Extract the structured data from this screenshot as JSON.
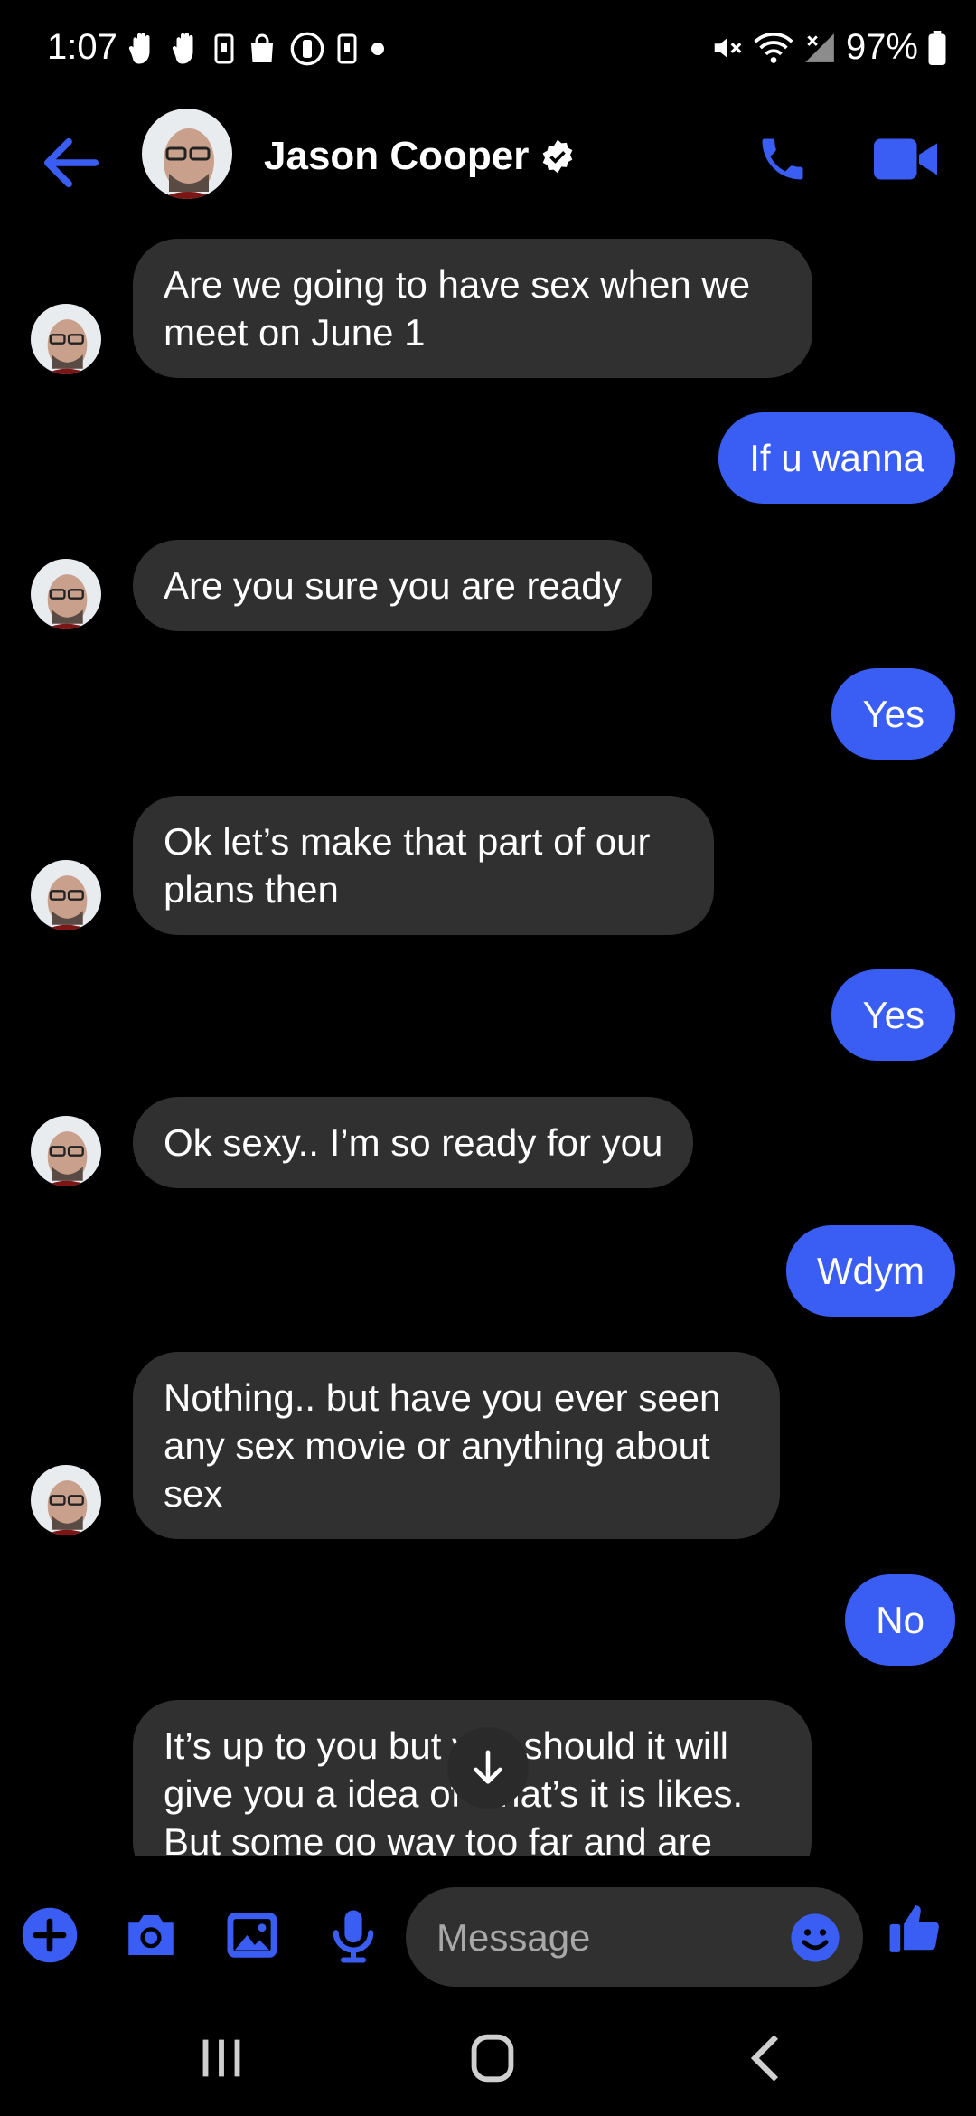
{
  "status_bar": {
    "time": "1:07",
    "battery": "97%"
  },
  "header": {
    "contact_name": "Jason Cooper",
    "accent_color": "#3a5ef4"
  },
  "messages": [
    {
      "sender": "contact",
      "text": "Are we going to have sex when we meet on June 1"
    },
    {
      "sender": "me",
      "text": "If u wanna"
    },
    {
      "sender": "contact",
      "text": "Are you sure you are ready"
    },
    {
      "sender": "me",
      "text": "Yes"
    },
    {
      "sender": "contact",
      "text": "Ok let’s make that part of our plans then"
    },
    {
      "sender": "me",
      "text": "Yes"
    },
    {
      "sender": "contact",
      "text": "Ok sexy.. I’m so ready for you"
    },
    {
      "sender": "me",
      "text": "Wdym"
    },
    {
      "sender": "contact",
      "text": "Nothing.. but have you ever seen any sex movie or anything about sex"
    },
    {
      "sender": "me",
      "text": "No"
    },
    {
      "sender": "contact",
      "text": "It’s up to you but you should it will give you a idea of what’s it is likes. But some go way too far and are"
    }
  ],
  "composer": {
    "placeholder": "Message"
  },
  "icons": {
    "back": "arrow-left-icon",
    "call": "phone-icon",
    "video": "video-camera-icon",
    "verified": "verified-badge-icon",
    "add": "plus-circle-icon",
    "camera": "camera-icon",
    "gallery": "image-icon",
    "mic": "microphone-icon",
    "emoji": "emoji-icon",
    "like": "thumbs-up-icon",
    "scroll": "arrow-down-icon"
  }
}
